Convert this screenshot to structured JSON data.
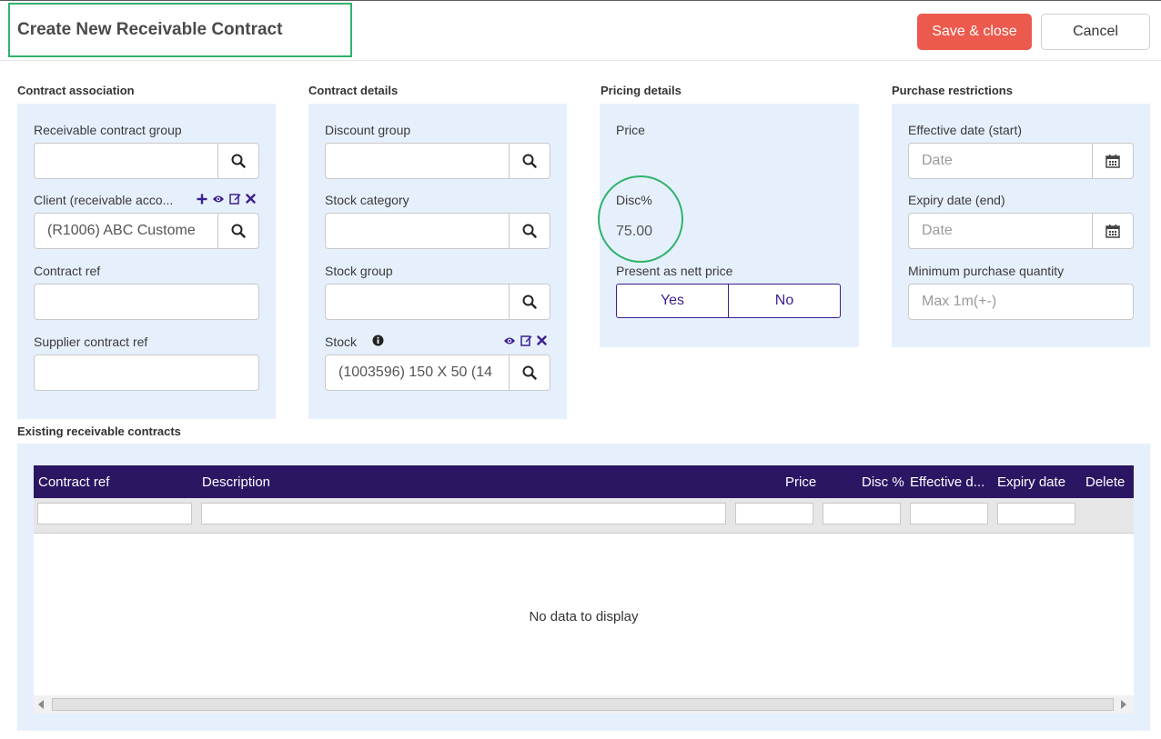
{
  "header": {
    "title": "Create New Receivable Contract",
    "save_label": "Save & close",
    "cancel_label": "Cancel"
  },
  "contract_association": {
    "title": "Contract association",
    "receivable_group_label": "Receivable contract group",
    "receivable_group_value": "",
    "client_label": "Client (receivable acco...",
    "client_value": "(R1006) ABC Custome",
    "contract_ref_label": "Contract ref",
    "contract_ref_value": "",
    "supplier_ref_label": "Supplier contract ref",
    "supplier_ref_value": ""
  },
  "contract_details": {
    "title": "Contract details",
    "discount_group_label": "Discount group",
    "stock_category_label": "Stock category",
    "stock_group_label": "Stock group",
    "stock_label": "Stock",
    "stock_value": "(1003596) 150 X 50 (14"
  },
  "pricing_details": {
    "title": "Pricing details",
    "price_label": "Price",
    "disc_label": "Disc%",
    "disc_value": "75.00",
    "nett_label": "Present as nett price",
    "yes_label": "Yes",
    "no_label": "No"
  },
  "purchase_restrictions": {
    "title": "Purchase restrictions",
    "effective_label": "Effective date (start)",
    "effective_placeholder": "Date",
    "expiry_label": "Expiry date (end)",
    "expiry_placeholder": "Date",
    "min_qty_label": "Minimum purchase quantity",
    "min_qty_placeholder": "Max 1m(+-)"
  },
  "existing": {
    "title": "Existing receivable contracts",
    "columns": [
      "Contract ref",
      "Description",
      "Price",
      "Disc %",
      "Effective d...",
      "Expiry date",
      "Delete"
    ],
    "empty_text": "No data to display"
  },
  "colors": {
    "accent_purple": "#2b1664",
    "save_red": "#ec5a4d",
    "highlight_green": "#2fb36b",
    "panel_blue": "#e6f0fd"
  }
}
